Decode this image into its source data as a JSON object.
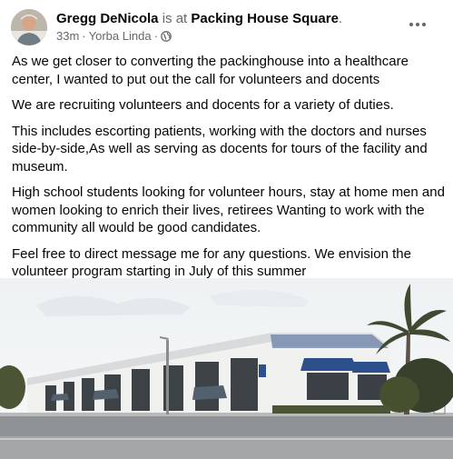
{
  "post": {
    "author": "Gregg DeNicola",
    "is_at": " is at ",
    "place": "Packing House Square",
    "place_suffix": ".",
    "time": "33m",
    "separator": "·",
    "location": "Yorba Linda",
    "paragraphs": [
      "As we get closer to converting the packinghouse into a healthcare center, I wanted to put out the call for volunteers and docents",
      "We are recruiting volunteers and docents for a variety of duties.",
      "This includes escorting patients, working with the doctors and nurses side-by-side,As well as serving as docents for tours of the facility and museum.",
      "High school students looking for volunteer hours, stay at home men and women looking to enrich their lives, retirees Wanting to work with the community all would be good candidates.",
      "Feel free to direct message me for any questions. We envision the volunteer program starting in July of this summer"
    ]
  },
  "icons": {
    "privacy": "globe-icon",
    "menu": "more-options-icon"
  },
  "colors": {
    "text": "#050505",
    "secondary": "#65676b",
    "awning": "#2d4f8c"
  }
}
